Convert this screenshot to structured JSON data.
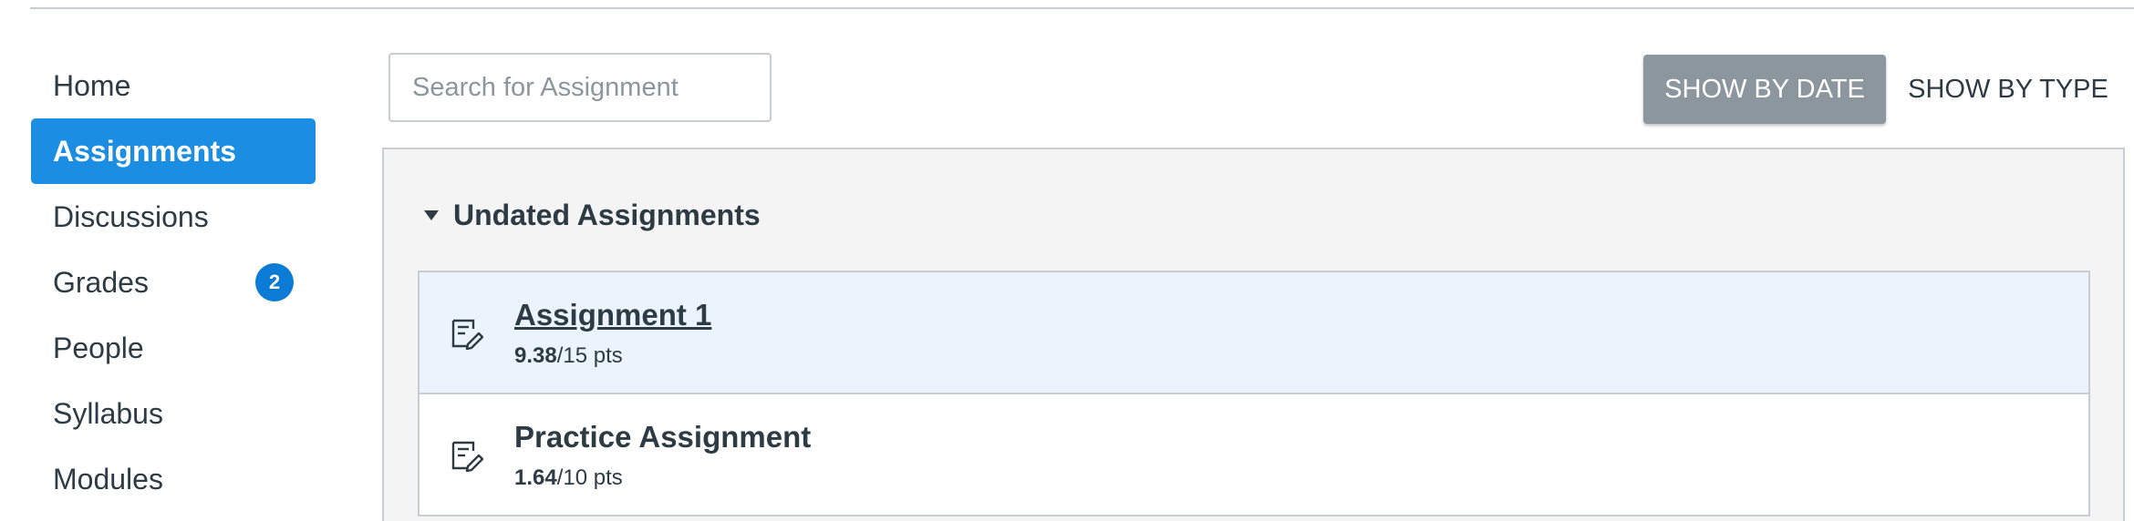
{
  "sidebar": {
    "items": [
      {
        "label": "Home"
      },
      {
        "label": "Assignments",
        "active": true
      },
      {
        "label": "Discussions"
      },
      {
        "label": "Grades",
        "badge": "2"
      },
      {
        "label": "People"
      },
      {
        "label": "Syllabus"
      },
      {
        "label": "Modules"
      }
    ]
  },
  "toolbar": {
    "search_placeholder": "Search for Assignment",
    "search_value": "",
    "show_by_date_label": "SHOW BY DATE",
    "show_by_type_label": "SHOW BY TYPE"
  },
  "group": {
    "title": "Undated Assignments",
    "assignments": [
      {
        "title": "Assignment 1",
        "score": "9.38",
        "points": "/15 pts",
        "icon": "assignment-icon"
      },
      {
        "title": "Practice Assignment",
        "score": "1.64",
        "points": "/10 pts",
        "icon": "assignment-icon"
      }
    ]
  },
  "colors": {
    "accent": "#1b8ee3",
    "badge": "#0b7bd6",
    "button_gray": "#8b969e",
    "row_highlight": "#ebf4fd",
    "text": "#2d3b45"
  }
}
